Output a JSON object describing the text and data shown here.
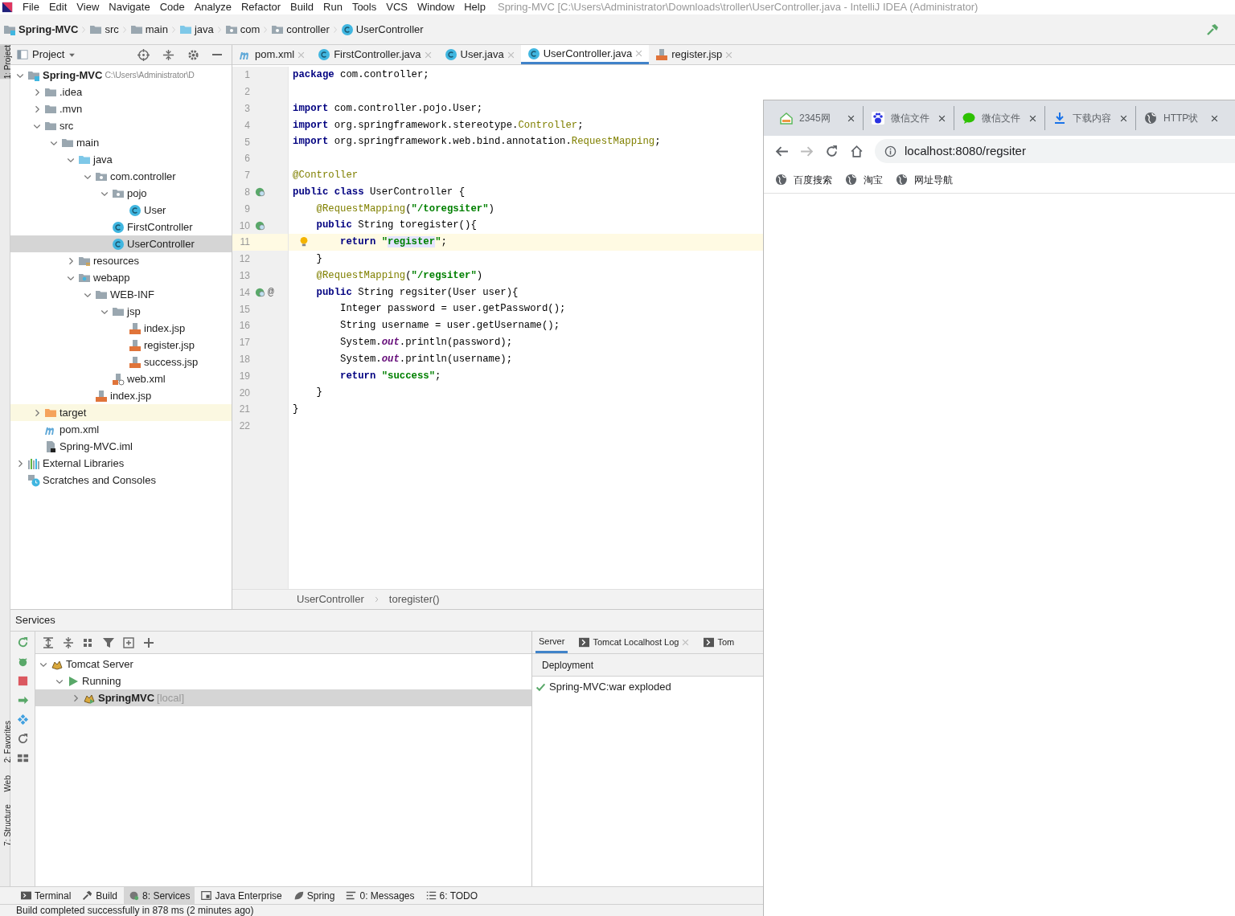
{
  "menu_bar": {
    "items": [
      "File",
      "Edit",
      "View",
      "Navigate",
      "Code",
      "Analyze",
      "Refactor",
      "Build",
      "Run",
      "Tools",
      "VCS",
      "Window",
      "Help"
    ],
    "title": "Spring-MVC [C:\\Users\\Administrator\\Downloads\\troller\\UserController.java - IntelliJ IDEA (Administrator)"
  },
  "breadcrumbs": [
    {
      "label": "Spring-MVC",
      "kind": "module"
    },
    {
      "label": "src",
      "kind": "folder"
    },
    {
      "label": "main",
      "kind": "folder"
    },
    {
      "label": "java",
      "kind": "source"
    },
    {
      "label": "com",
      "kind": "package"
    },
    {
      "label": "controller",
      "kind": "package"
    },
    {
      "label": "UserController",
      "kind": "class"
    }
  ],
  "project_panel": {
    "title": "Project",
    "tree": [
      {
        "label": "Spring-MVC",
        "path": "C:\\Users\\Administrator\\D",
        "kind": "module",
        "expanded": true,
        "selected": false,
        "children": [
          {
            "label": ".idea",
            "kind": "folder",
            "expanded": false,
            "selected": false
          },
          {
            "label": ".mvn",
            "kind": "folder",
            "expanded": false,
            "selected": false
          },
          {
            "label": "src",
            "kind": "folder",
            "expanded": true,
            "selected": false,
            "children": [
              {
                "label": "main",
                "kind": "folder",
                "expanded": true,
                "selected": false,
                "children": [
                  {
                    "label": "java",
                    "kind": "source",
                    "expanded": true,
                    "selected": false,
                    "children": [
                      {
                        "label": "com.controller",
                        "kind": "package",
                        "expanded": true,
                        "selected": false,
                        "children": [
                          {
                            "label": "pojo",
                            "kind": "package",
                            "expanded": true,
                            "selected": false,
                            "children": [
                              {
                                "label": "User",
                                "kind": "class",
                                "selected": false
                              }
                            ]
                          },
                          {
                            "label": "FirstController",
                            "kind": "class",
                            "selected": false
                          },
                          {
                            "label": "UserController",
                            "kind": "class",
                            "selected": true
                          }
                        ]
                      }
                    ]
                  },
                  {
                    "label": "resources",
                    "kind": "resources",
                    "expanded": false,
                    "selected": false
                  },
                  {
                    "label": "webapp",
                    "kind": "webapp",
                    "expanded": true,
                    "selected": false,
                    "children": [
                      {
                        "label": "WEB-INF",
                        "kind": "folder",
                        "expanded": true,
                        "selected": false,
                        "children": [
                          {
                            "label": "jsp",
                            "kind": "folder",
                            "expanded": true,
                            "selected": false,
                            "children": [
                              {
                                "label": "index.jsp",
                                "kind": "jsp",
                                "selected": false
                              },
                              {
                                "label": "register.jsp",
                                "kind": "jsp",
                                "selected": false
                              },
                              {
                                "label": "success.jsp",
                                "kind": "jsp",
                                "selected": false
                              }
                            ]
                          },
                          {
                            "label": "web.xml",
                            "kind": "xml",
                            "selected": false
                          }
                        ]
                      },
                      {
                        "label": "index.jsp",
                        "kind": "jsp",
                        "selected": false
                      }
                    ]
                  }
                ]
              }
            ]
          },
          {
            "label": "target",
            "kind": "excluded",
            "expanded": false,
            "selected": false
          },
          {
            "label": "pom.xml",
            "kind": "maven",
            "selected": false
          },
          {
            "label": "Spring-MVC.iml",
            "kind": "iml",
            "selected": false
          }
        ]
      },
      {
        "label": "External Libraries",
        "kind": "libraries",
        "expanded": false,
        "selected": false
      },
      {
        "label": "Scratches and Consoles",
        "kind": "scratches",
        "selected": false
      }
    ]
  },
  "editor_tabs": [
    {
      "label": "pom.xml",
      "kind": "maven",
      "selected": false
    },
    {
      "label": "FirstController.java",
      "kind": "class",
      "selected": false
    },
    {
      "label": "User.java",
      "kind": "class",
      "selected": false
    },
    {
      "label": "UserController.java",
      "kind": "class",
      "selected": true
    },
    {
      "label": "register.jsp",
      "kind": "jsp",
      "selected": false
    }
  ],
  "editor": {
    "lines": [
      {
        "number": "1",
        "kind": "plain",
        "current": false,
        "segments": [
          {
            "kind": "kw",
            "text": "package"
          },
          {
            "kind": "plain",
            "text": " com.controller;"
          }
        ]
      },
      {
        "number": "2",
        "kind": "plain",
        "current": false
      },
      {
        "number": "3",
        "kind": "plain",
        "current": false,
        "segments": [
          {
            "kind": "kw",
            "text": "import"
          },
          {
            "kind": "plain",
            "text": " com.controller.pojo.User;"
          }
        ]
      },
      {
        "number": "4",
        "kind": "plain",
        "current": false,
        "segments": [
          {
            "kind": "kw",
            "text": "import"
          },
          {
            "kind": "plain",
            "text": " org.springframework.stereotype."
          },
          {
            "kind": "ann",
            "text": "Controller"
          },
          {
            "kind": "plain",
            "text": ";"
          }
        ]
      },
      {
        "number": "5",
        "kind": "plain",
        "current": false,
        "segments": [
          {
            "kind": "kw",
            "text": "import"
          },
          {
            "kind": "plain",
            "text": " org.springframework.web.bind.annotation."
          },
          {
            "kind": "ann",
            "text": "RequestMapping"
          },
          {
            "kind": "plain",
            "text": ";"
          }
        ]
      },
      {
        "number": "6",
        "kind": "plain",
        "current": false
      },
      {
        "number": "7",
        "kind": "plain",
        "current": false,
        "segments": [
          {
            "kind": "ann",
            "text": "@Controller"
          }
        ]
      },
      {
        "number": "8",
        "kind": "bean",
        "current": false,
        "segments": [
          {
            "kind": "kw",
            "text": "public class"
          },
          {
            "kind": "plain",
            "text": " UserController {"
          }
        ]
      },
      {
        "number": "9",
        "kind": "plain",
        "current": false,
        "segments": [
          {
            "kind": "ann",
            "text": "    @RequestMapping"
          },
          {
            "kind": "plain",
            "text": "("
          },
          {
            "kind": "str",
            "text": "\"/toregsiter\""
          },
          {
            "kind": "plain",
            "text": ")"
          }
        ]
      },
      {
        "number": "10",
        "kind": "bean",
        "current": false,
        "segments": [
          {
            "kind": "kw",
            "text": "    public"
          },
          {
            "kind": "plain",
            "text": " String toregister(){"
          }
        ]
      },
      {
        "number": "11",
        "kind": "bulb",
        "current": true,
        "segments": [
          {
            "kind": "kw",
            "text": "        return"
          },
          {
            "kind": "str",
            "text": " \""
          },
          {
            "kind": "str-marked",
            "text": "register"
          },
          {
            "kind": "str",
            "text": "\""
          },
          {
            "kind": "plain",
            "text": ";"
          }
        ]
      },
      {
        "number": "12",
        "kind": "plain",
        "current": false,
        "segments": [
          {
            "kind": "plain",
            "text": "    }"
          }
        ]
      },
      {
        "number": "13",
        "kind": "plain",
        "current": false,
        "segments": [
          {
            "kind": "ann",
            "text": "    @RequestMapping"
          },
          {
            "kind": "plain",
            "text": "("
          },
          {
            "kind": "str",
            "text": "\"/regsiter\""
          },
          {
            "kind": "plain",
            "text": ")"
          }
        ]
      },
      {
        "number": "14",
        "kind": "bean",
        "mark": "@",
        "current": false,
        "segments": [
          {
            "kind": "kw",
            "text": "    public"
          },
          {
            "kind": "plain",
            "text": " String regsiter(User user){"
          }
        ]
      },
      {
        "number": "15",
        "kind": "plain",
        "current": false,
        "segments": [
          {
            "kind": "plain",
            "text": "        Integer password = user.getPassword();"
          }
        ]
      },
      {
        "number": "16",
        "kind": "plain",
        "current": false,
        "segments": [
          {
            "kind": "plain",
            "text": "        String username = user.getUsername();"
          }
        ]
      },
      {
        "number": "17",
        "kind": "plain",
        "current": false,
        "segments": [
          {
            "kind": "plain",
            "text": "        System."
          },
          {
            "kind": "static",
            "text": "out"
          },
          {
            "kind": "plain",
            "text": ".println(password);"
          }
        ]
      },
      {
        "number": "18",
        "kind": "plain",
        "current": false,
        "segments": [
          {
            "kind": "plain",
            "text": "        System."
          },
          {
            "kind": "static",
            "text": "out"
          },
          {
            "kind": "plain",
            "text": ".println(username);"
          }
        ]
      },
      {
        "number": "19",
        "kind": "plain",
        "current": false,
        "segments": [
          {
            "kind": "kw",
            "text": "        return"
          },
          {
            "kind": "str",
            "text": " \"success\""
          },
          {
            "kind": "plain",
            "text": ";"
          }
        ]
      },
      {
        "number": "20",
        "kind": "plain",
        "current": false,
        "segments": [
          {
            "kind": "plain",
            "text": "    }"
          }
        ]
      },
      {
        "number": "21",
        "kind": "plain",
        "current": false,
        "segments": [
          {
            "kind": "plain",
            "text": "}"
          }
        ]
      },
      {
        "number": "22",
        "kind": "plain",
        "current": false
      }
    ],
    "breadcrumb": [
      "UserController",
      "toregister()"
    ]
  },
  "services": {
    "title": "Services",
    "tree": [
      {
        "label": "Tomcat Server",
        "kind": "tomcat",
        "expanded": true,
        "selected": false,
        "children": [
          {
            "label": "Running",
            "kind": "run",
            "expanded": true,
            "selected": false,
            "children": [
              {
                "label": "SpringMVC",
                "note": "[local]",
                "kind": "tomcat-run",
                "expanded": false,
                "selected": true
              }
            ]
          }
        ]
      }
    ],
    "tabs": [
      {
        "label": "Server",
        "selected": true,
        "closable": false
      },
      {
        "label": "Tomcat Localhost Log",
        "selected": false,
        "closable": true
      },
      {
        "label": "Tom",
        "selected": false,
        "closable": false
      }
    ],
    "deployment_header": "Deployment",
    "deployments": [
      "Spring-MVC:war exploded"
    ]
  },
  "side_stripe": {
    "top": [
      "1: Project"
    ],
    "bottom": [
      "2: Favorites",
      "Web",
      "7: Structure"
    ]
  },
  "tool_tabs": [
    {
      "label": "Terminal",
      "selected": false
    },
    {
      "label": "Build",
      "selected": false
    },
    {
      "label": "8: Services",
      "selected": true
    },
    {
      "label": "Java Enterprise",
      "selected": false
    },
    {
      "label": "Spring",
      "selected": false
    },
    {
      "label": "0: Messages",
      "selected": false
    },
    {
      "label": "6: TODO",
      "selected": false
    }
  ],
  "status_bar": "Build completed successfully in 878 ms (2 minutes ago)",
  "browser": {
    "tabs": [
      {
        "label": "2345网",
        "kind": "house"
      },
      {
        "label": "微信文件",
        "kind": "paw"
      },
      {
        "label": "微信文件",
        "kind": "chat"
      },
      {
        "label": "下载内容",
        "kind": "download"
      },
      {
        "label": "HTTP状",
        "kind": "globe"
      }
    ],
    "url": "localhost:8080/regsiter",
    "bookmarks": [
      "百度搜索",
      "淘宝",
      "网址导航"
    ]
  }
}
